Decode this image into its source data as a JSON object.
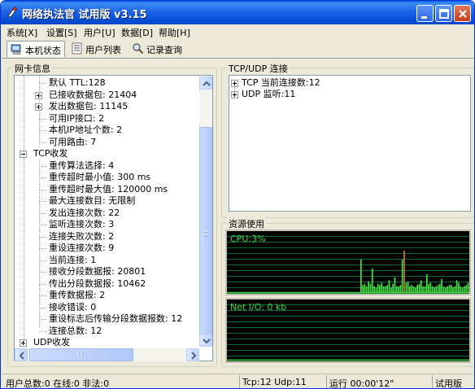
{
  "window": {
    "title": "网络执法官 试用版 v3.15"
  },
  "menu": [
    {
      "label": "系统[X]"
    },
    {
      "label": "设置[S]"
    },
    {
      "label": "用户[U]"
    },
    {
      "label": "数据[D]"
    },
    {
      "label": "帮助[H]"
    }
  ],
  "tabs": [
    {
      "label": "本机状态",
      "icon": "computer-icon",
      "active": true
    },
    {
      "label": "用户列表",
      "icon": "list-icon",
      "active": false
    },
    {
      "label": "记录查询",
      "icon": "magnifier-icon",
      "active": false
    }
  ],
  "nic_panel": {
    "title": "网卡信息",
    "tree": [
      {
        "label": "默认 TTL:128",
        "expander": "none"
      },
      {
        "label": "已接收数据包: 21404",
        "expander": "closed"
      },
      {
        "label": "发出数据包: 11145",
        "expander": "closed"
      },
      {
        "label": "可用IP接口: 2",
        "expander": "none"
      },
      {
        "label": "本机IP地址个数: 2",
        "expander": "none"
      },
      {
        "label": "可用路由: 7",
        "expander": "none"
      },
      {
        "label": "TCP收发",
        "expander": "open"
      },
      {
        "label": "重传算法选择: 4",
        "expander": "none"
      },
      {
        "label": "重传超时最小值: 300 ms",
        "expander": "none"
      },
      {
        "label": "重传超时最大值: 120000 ms",
        "expander": "none"
      },
      {
        "label": "最大连接数目: 无限制",
        "expander": "none"
      },
      {
        "label": "发出连接次数: 22",
        "expander": "none"
      },
      {
        "label": "监听连接次数: 3",
        "expander": "none"
      },
      {
        "label": "连接失败次数: 2",
        "expander": "none"
      },
      {
        "label": "重设连接次数: 9",
        "expander": "none"
      },
      {
        "label": "当前连接: 1",
        "expander": "none"
      },
      {
        "label": "接收分段数据报: 20801",
        "expander": "none"
      },
      {
        "label": "传出分段数据报: 10462",
        "expander": "none"
      },
      {
        "label": "重传数据报: 2",
        "expander": "none"
      },
      {
        "label": "接收错误: 0",
        "expander": "none"
      },
      {
        "label": "重设标志后传输分段数据报数: 12",
        "expander": "none"
      },
      {
        "label": "连接总数: 12",
        "expander": "none"
      },
      {
        "label": "UDP收发",
        "expander": "closed"
      }
    ]
  },
  "conn_panel": {
    "title": "TCP/UDP 连接",
    "items": [
      {
        "label": "TCP 当前连接数:12"
      },
      {
        "label": "UDP 监听:11"
      }
    ]
  },
  "resource_panel": {
    "title": "资源使用",
    "cpu_label": "CPU:3%",
    "net_label": "Net I/O: 0 kb",
    "cpu_history_percent": [
      0,
      0,
      0,
      0,
      0,
      0,
      0,
      0,
      0,
      0,
      0,
      0,
      0,
      0,
      0,
      0,
      0,
      0,
      0,
      0,
      0,
      0,
      0,
      0,
      0,
      0,
      0,
      0,
      0,
      0,
      0,
      0,
      0,
      0,
      0,
      0,
      0,
      0,
      0,
      0,
      0,
      0,
      0,
      0,
      0,
      0,
      0,
      0,
      0,
      0,
      0,
      0,
      0,
      0,
      0,
      0,
      0,
      0,
      0,
      0,
      0,
      0,
      0,
      0,
      0,
      0,
      0,
      0,
      0,
      0,
      0,
      55,
      12,
      14,
      10,
      18,
      14,
      40,
      10,
      8,
      14,
      12,
      16,
      10,
      10,
      12,
      20,
      8,
      14,
      25,
      10,
      10,
      12,
      55,
      70,
      16,
      18,
      10,
      12,
      10,
      8,
      12,
      14,
      20,
      10,
      10,
      30,
      14,
      16,
      10,
      8,
      10,
      12,
      14,
      22,
      10,
      8,
      10,
      12,
      12,
      8,
      10,
      20,
      16,
      10,
      8,
      10,
      12,
      16
    ]
  },
  "status": {
    "users": "用户总数:0 在线:0 非法:0",
    "tcpudp": "Tcp:12 Udp:11",
    "runtime": "运行 00:00'12\"",
    "edition": "试用版"
  },
  "colors": {
    "titlebar": "#0A5FE8",
    "graph_bg": "#000000",
    "graph_grid": "#0B6B2E",
    "graph_line": "#3FD63F",
    "cpu_bar": "#44E244",
    "cpu_peak": "#C07A3A"
  }
}
